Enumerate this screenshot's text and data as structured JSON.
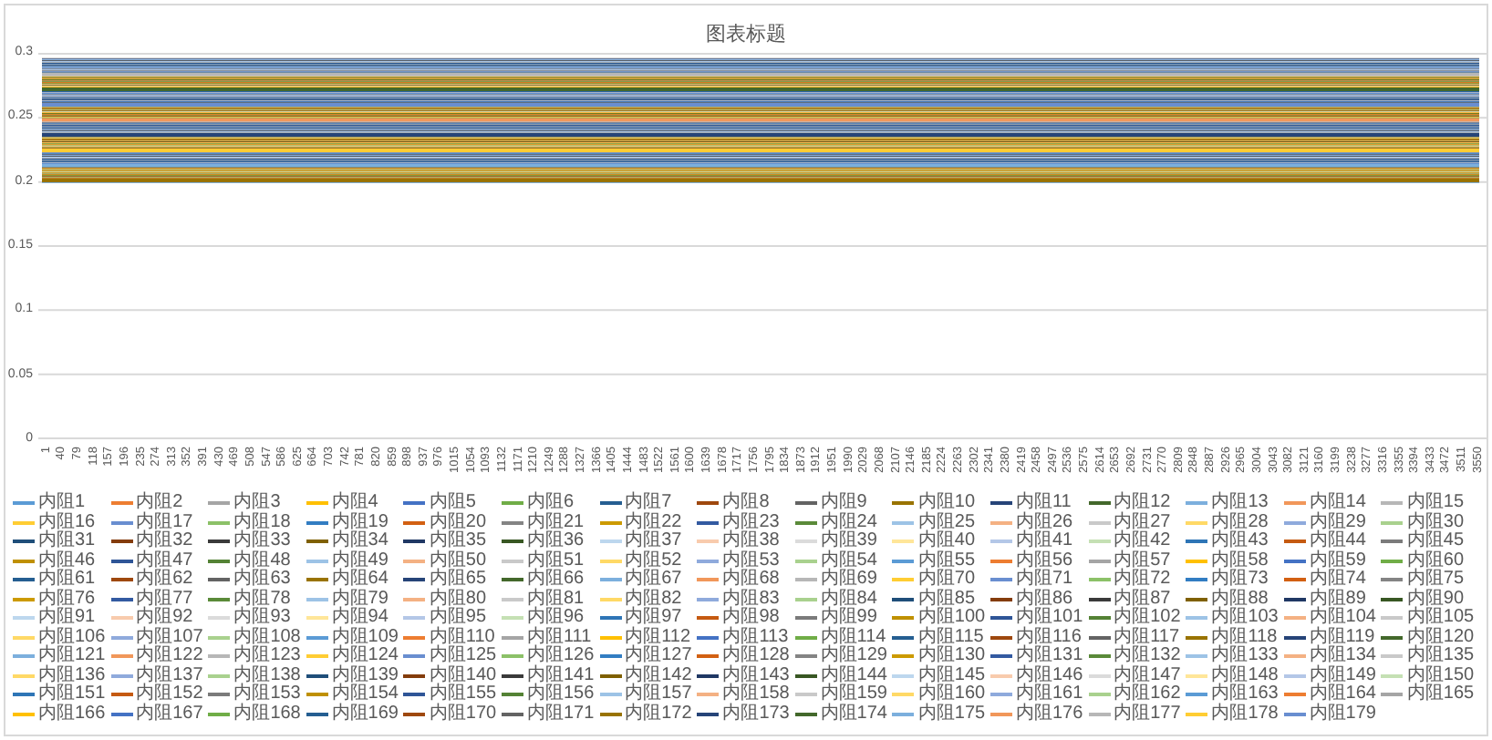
{
  "chart": {
    "title": "图表标题",
    "y_axis": {
      "ticks": [
        "0.3",
        "0.25",
        "0.2",
        "0.15",
        "0.1",
        "0.05",
        "0"
      ]
    },
    "x_axis": {
      "ticks": [
        "1",
        "40",
        "79",
        "118",
        "157",
        "196",
        "235",
        "274",
        "313",
        "352",
        "391",
        "430",
        "469",
        "508",
        "547",
        "586",
        "625",
        "664",
        "703",
        "742",
        "781",
        "820",
        "859",
        "898",
        "937",
        "976",
        "1015",
        "1054",
        "1093",
        "1132",
        "1171",
        "1210",
        "1249",
        "1288",
        "1327",
        "1366",
        "1405",
        "1444",
        "1483",
        "1522",
        "1561",
        "1600",
        "1639",
        "1678",
        "1717",
        "1756",
        "1795",
        "1834",
        "1873",
        "1912",
        "1951",
        "1990",
        "2029",
        "2068",
        "2107",
        "2146",
        "2185",
        "2224",
        "2263",
        "2302",
        "2341",
        "2380",
        "2419",
        "2458",
        "2497",
        "2536",
        "2575",
        "2614",
        "2653",
        "2692",
        "2731",
        "2770",
        "2809",
        "2848",
        "2887",
        "2926",
        "2965",
        "3004",
        "3043",
        "3082",
        "3121",
        "3160",
        "3199",
        "3238",
        "3277",
        "3316",
        "3355",
        "3394",
        "3433",
        "3472",
        "3511",
        "3550"
      ]
    },
    "legend": [
      {
        "label": "内阻1",
        "color": "#5b9bd5"
      },
      {
        "label": "内阻2",
        "color": "#ed7d31"
      },
      {
        "label": "内阻3",
        "color": "#a5a5a5"
      },
      {
        "label": "内阻4",
        "color": "#ffc000"
      },
      {
        "label": "内阻5",
        "color": "#4472c4"
      },
      {
        "label": "内阻6",
        "color": "#70ad47"
      },
      {
        "label": "内阻7",
        "color": "#255e91"
      },
      {
        "label": "内阻8",
        "color": "#9e480e"
      },
      {
        "label": "内阻9",
        "color": "#636363"
      },
      {
        "label": "内阻10",
        "color": "#997300"
      },
      {
        "label": "内阻11",
        "color": "#264478"
      },
      {
        "label": "内阻12",
        "color": "#43682b"
      },
      {
        "label": "内阻13",
        "color": "#7cafdd"
      },
      {
        "label": "内阻14",
        "color": "#f1975a"
      },
      {
        "label": "内阻15",
        "color": "#b7b7b7"
      },
      {
        "label": "内阻16",
        "color": "#ffcd33"
      },
      {
        "label": "内阻17",
        "color": "#698ed0"
      },
      {
        "label": "内阻18",
        "color": "#8cc168"
      },
      {
        "label": "内阻19",
        "color": "#327dc2"
      },
      {
        "label": "内阻20",
        "color": "#d26012"
      },
      {
        "label": "内阻21",
        "color": "#848484"
      },
      {
        "label": "内阻22",
        "color": "#cc9a00"
      },
      {
        "label": "内阻23",
        "color": "#335aa1"
      },
      {
        "label": "内阻24",
        "color": "#5a8a39"
      },
      {
        "label": "内阻25",
        "color": "#9dc3e6"
      },
      {
        "label": "内阻26",
        "color": "#f4b183"
      },
      {
        "label": "内阻27",
        "color": "#c9c9c9"
      },
      {
        "label": "内阻28",
        "color": "#ffd966"
      },
      {
        "label": "内阻29",
        "color": "#8faadc"
      },
      {
        "label": "内阻30",
        "color": "#a9d18e"
      },
      {
        "label": "内阻31",
        "color": "#1f4e79"
      },
      {
        "label": "内阻32",
        "color": "#843c0c"
      },
      {
        "label": "内阻33",
        "color": "#3a3a3a"
      },
      {
        "label": "内阻34",
        "color": "#7f6000"
      },
      {
        "label": "内阻35",
        "color": "#203864"
      },
      {
        "label": "内阻36",
        "color": "#385723"
      },
      {
        "label": "内阻37",
        "color": "#bdd7ee"
      },
      {
        "label": "内阻38",
        "color": "#f8cbad"
      },
      {
        "label": "内阻39",
        "color": "#dbdbdb"
      },
      {
        "label": "内阻40",
        "color": "#ffe699"
      },
      {
        "label": "内阻41",
        "color": "#b4c7e7"
      },
      {
        "label": "内阻42",
        "color": "#c5e0b4"
      },
      {
        "label": "内阻43",
        "color": "#2e75b6"
      },
      {
        "label": "内阻44",
        "color": "#c55a11"
      },
      {
        "label": "内阻45",
        "color": "#7b7b7b"
      },
      {
        "label": "内阻46",
        "color": "#bf9000"
      },
      {
        "label": "内阻47",
        "color": "#2f5597"
      },
      {
        "label": "内阻48",
        "color": "#548235"
      },
      {
        "label": "内阻49",
        "color": "#9dc3e6"
      },
      {
        "label": "内阻50",
        "color": "#f4b183"
      },
      {
        "label": "内阻51",
        "color": "#c9c9c9"
      },
      {
        "label": "内阻52",
        "color": "#ffd966"
      },
      {
        "label": "内阻53",
        "color": "#8faadc"
      },
      {
        "label": "内阻54",
        "color": "#a9d18e"
      },
      {
        "label": "内阻55",
        "color": "#5b9bd5"
      },
      {
        "label": "内阻56",
        "color": "#ed7d31"
      },
      {
        "label": "内阻57",
        "color": "#a5a5a5"
      },
      {
        "label": "内阻58",
        "color": "#ffc000"
      },
      {
        "label": "内阻59",
        "color": "#4472c4"
      },
      {
        "label": "内阻60",
        "color": "#70ad47"
      },
      {
        "label": "内阻61",
        "color": "#255e91"
      },
      {
        "label": "内阻62",
        "color": "#9e480e"
      },
      {
        "label": "内阻63",
        "color": "#636363"
      },
      {
        "label": "内阻64",
        "color": "#997300"
      },
      {
        "label": "内阻65",
        "color": "#264478"
      },
      {
        "label": "内阻66",
        "color": "#43682b"
      },
      {
        "label": "内阻67",
        "color": "#7cafdd"
      },
      {
        "label": "内阻68",
        "color": "#f1975a"
      },
      {
        "label": "内阻69",
        "color": "#b7b7b7"
      },
      {
        "label": "内阻70",
        "color": "#ffcd33"
      },
      {
        "label": "内阻71",
        "color": "#698ed0"
      },
      {
        "label": "内阻72",
        "color": "#8cc168"
      },
      {
        "label": "内阻73",
        "color": "#327dc2"
      },
      {
        "label": "内阻74",
        "color": "#d26012"
      },
      {
        "label": "内阻75",
        "color": "#848484"
      },
      {
        "label": "内阻76",
        "color": "#cc9a00"
      },
      {
        "label": "内阻77",
        "color": "#335aa1"
      },
      {
        "label": "内阻78",
        "color": "#5a8a39"
      },
      {
        "label": "内阻79",
        "color": "#9dc3e6"
      },
      {
        "label": "内阻80",
        "color": "#f4b183"
      },
      {
        "label": "内阻81",
        "color": "#c9c9c9"
      },
      {
        "label": "内阻82",
        "color": "#ffd966"
      },
      {
        "label": "内阻83",
        "color": "#8faadc"
      },
      {
        "label": "内阻84",
        "color": "#a9d18e"
      },
      {
        "label": "内阻85",
        "color": "#1f4e79"
      },
      {
        "label": "内阻86",
        "color": "#843c0c"
      },
      {
        "label": "内阻87",
        "color": "#3a3a3a"
      },
      {
        "label": "内阻88",
        "color": "#7f6000"
      },
      {
        "label": "内阻89",
        "color": "#203864"
      },
      {
        "label": "内阻90",
        "color": "#385723"
      },
      {
        "label": "内阻91",
        "color": "#bdd7ee"
      },
      {
        "label": "内阻92",
        "color": "#f8cbad"
      },
      {
        "label": "内阻93",
        "color": "#dbdbdb"
      },
      {
        "label": "内阻94",
        "color": "#ffe699"
      },
      {
        "label": "内阻95",
        "color": "#b4c7e7"
      },
      {
        "label": "内阻96",
        "color": "#c5e0b4"
      },
      {
        "label": "内阻97",
        "color": "#2e75b6"
      },
      {
        "label": "内阻98",
        "color": "#c55a11"
      },
      {
        "label": "内阻99",
        "color": "#7b7b7b"
      },
      {
        "label": "内阻100",
        "color": "#bf9000"
      },
      {
        "label": "内阻101",
        "color": "#2f5597"
      },
      {
        "label": "内阻102",
        "color": "#548235"
      },
      {
        "label": "内阻103",
        "color": "#9dc3e6"
      },
      {
        "label": "内阻104",
        "color": "#f4b183"
      },
      {
        "label": "内阻105",
        "color": "#c9c9c9"
      },
      {
        "label": "内阻106",
        "color": "#ffd966"
      },
      {
        "label": "内阻107",
        "color": "#8faadc"
      },
      {
        "label": "内阻108",
        "color": "#a9d18e"
      },
      {
        "label": "内阻109",
        "color": "#5b9bd5"
      },
      {
        "label": "内阻110",
        "color": "#ed7d31"
      },
      {
        "label": "内阻111",
        "color": "#a5a5a5"
      },
      {
        "label": "内阻112",
        "color": "#ffc000"
      },
      {
        "label": "内阻113",
        "color": "#4472c4"
      },
      {
        "label": "内阻114",
        "color": "#70ad47"
      },
      {
        "label": "内阻115",
        "color": "#255e91"
      },
      {
        "label": "内阻116",
        "color": "#9e480e"
      },
      {
        "label": "内阻117",
        "color": "#636363"
      },
      {
        "label": "内阻118",
        "color": "#997300"
      },
      {
        "label": "内阻119",
        "color": "#264478"
      },
      {
        "label": "内阻120",
        "color": "#43682b"
      },
      {
        "label": "内阻121",
        "color": "#7cafdd"
      },
      {
        "label": "内阻122",
        "color": "#f1975a"
      },
      {
        "label": "内阻123",
        "color": "#b7b7b7"
      },
      {
        "label": "内阻124",
        "color": "#ffcd33"
      },
      {
        "label": "内阻125",
        "color": "#698ed0"
      },
      {
        "label": "内阻126",
        "color": "#8cc168"
      },
      {
        "label": "内阻127",
        "color": "#327dc2"
      },
      {
        "label": "内阻128",
        "color": "#d26012"
      },
      {
        "label": "内阻129",
        "color": "#848484"
      },
      {
        "label": "内阻130",
        "color": "#cc9a00"
      },
      {
        "label": "内阻131",
        "color": "#335aa1"
      },
      {
        "label": "内阻132",
        "color": "#5a8a39"
      },
      {
        "label": "内阻133",
        "color": "#9dc3e6"
      },
      {
        "label": "内阻134",
        "color": "#f4b183"
      },
      {
        "label": "内阻135",
        "color": "#c9c9c9"
      },
      {
        "label": "内阻136",
        "color": "#ffd966"
      },
      {
        "label": "内阻137",
        "color": "#8faadc"
      },
      {
        "label": "内阻138",
        "color": "#a9d18e"
      },
      {
        "label": "内阻139",
        "color": "#1f4e79"
      },
      {
        "label": "内阻140",
        "color": "#843c0c"
      },
      {
        "label": "内阻141",
        "color": "#3a3a3a"
      },
      {
        "label": "内阻142",
        "color": "#7f6000"
      },
      {
        "label": "内阻143",
        "color": "#203864"
      },
      {
        "label": "内阻144",
        "color": "#385723"
      },
      {
        "label": "内阻145",
        "color": "#bdd7ee"
      },
      {
        "label": "内阻146",
        "color": "#f8cbad"
      },
      {
        "label": "内阻147",
        "color": "#dbdbdb"
      },
      {
        "label": "内阻148",
        "color": "#ffe699"
      },
      {
        "label": "内阻149",
        "color": "#b4c7e7"
      },
      {
        "label": "内阻150",
        "color": "#c5e0b4"
      },
      {
        "label": "内阻151",
        "color": "#2e75b6"
      },
      {
        "label": "内阻152",
        "color": "#c55a11"
      },
      {
        "label": "内阻153",
        "color": "#7b7b7b"
      },
      {
        "label": "内阻154",
        "color": "#bf9000"
      },
      {
        "label": "内阻155",
        "color": "#2f5597"
      },
      {
        "label": "内阻156",
        "color": "#548235"
      },
      {
        "label": "内阻157",
        "color": "#9dc3e6"
      },
      {
        "label": "内阻158",
        "color": "#f4b183"
      },
      {
        "label": "内阻159",
        "color": "#c9c9c9"
      },
      {
        "label": "内阻160",
        "color": "#ffd966"
      },
      {
        "label": "内阻161",
        "color": "#8faadc"
      },
      {
        "label": "内阻162",
        "color": "#a9d18e"
      },
      {
        "label": "内阻163",
        "color": "#5b9bd5"
      },
      {
        "label": "内阻164",
        "color": "#ed7d31"
      },
      {
        "label": "内阻165",
        "color": "#a5a5a5"
      },
      {
        "label": "内阻166",
        "color": "#ffc000"
      },
      {
        "label": "内阻167",
        "color": "#4472c4"
      },
      {
        "label": "内阻168",
        "color": "#70ad47"
      },
      {
        "label": "内阻169",
        "color": "#255e91"
      },
      {
        "label": "内阻170",
        "color": "#9e480e"
      },
      {
        "label": "内阻171",
        "color": "#636363"
      },
      {
        "label": "内阻172",
        "color": "#997300"
      },
      {
        "label": "内阻173",
        "color": "#264478"
      },
      {
        "label": "内阻174",
        "color": "#43682b"
      },
      {
        "label": "内阻175",
        "color": "#7cafdd"
      },
      {
        "label": "内阻176",
        "color": "#f1975a"
      },
      {
        "label": "内阻177",
        "color": "#b7b7b7"
      },
      {
        "label": "内阻178",
        "color": "#ffcd33"
      },
      {
        "label": "内阻179",
        "color": "#698ed0"
      }
    ]
  }
}
